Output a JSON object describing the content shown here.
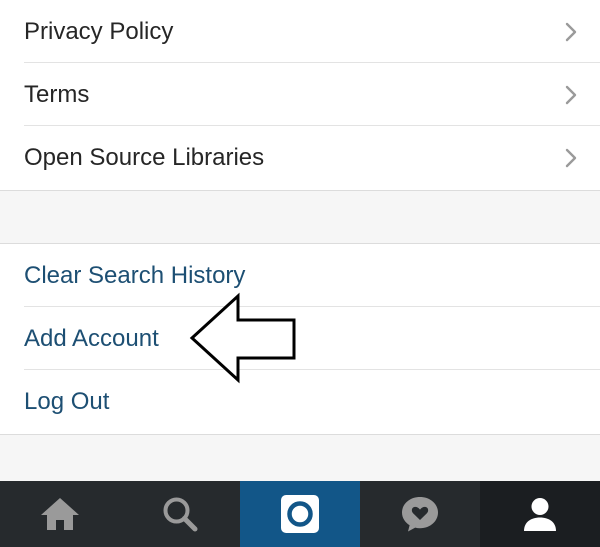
{
  "settings_links": [
    {
      "label": "Privacy Policy"
    },
    {
      "label": "Terms"
    },
    {
      "label": "Open Source Libraries"
    }
  ],
  "account_actions": [
    {
      "label": "Clear Search History"
    },
    {
      "label": "Add Account"
    },
    {
      "label": "Log Out"
    }
  ],
  "tab_bar": {
    "tabs": [
      {
        "icon": "home-icon"
      },
      {
        "icon": "search-icon"
      },
      {
        "icon": "camera-icon",
        "active": true
      },
      {
        "icon": "activity-heart-icon"
      },
      {
        "icon": "profile-icon"
      }
    ]
  },
  "colors": {
    "background": "#f6f6f6",
    "row_text": "#262626",
    "action_text": "#1d4f73",
    "tab_bar": "#262a2d",
    "tab_active": "#125688",
    "tab_icon": "#9a9a9a"
  }
}
